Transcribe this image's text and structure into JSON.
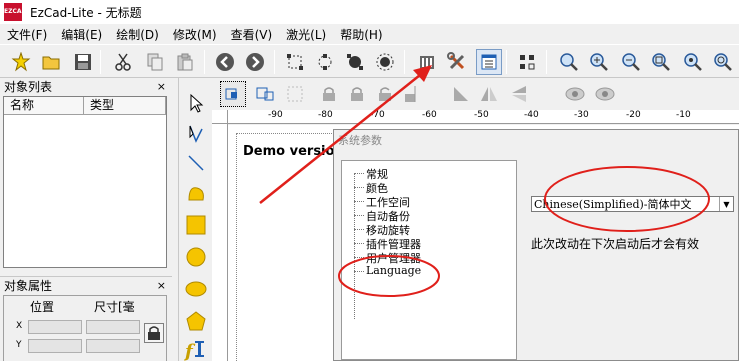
{
  "window": {
    "logo_text": "EZCAD",
    "title": "EzCad-Lite - 无标题"
  },
  "menu": [
    "文件(F)",
    "编辑(E)",
    "绘制(D)",
    "修改(M)",
    "查看(V)",
    "激光(L)",
    "帮助(H)"
  ],
  "toolbar": {
    "buttons": [
      "new-icon",
      "open-icon",
      "save-icon",
      "cut-icon",
      "copy-icon",
      "paste-icon",
      "undo-icon",
      "redo-icon",
      "node-edit-icon",
      "node-select-icon",
      "node-move-icon",
      "node-add-icon",
      "barcode-icon",
      "settings-tools-icon",
      "system-params-icon",
      "object-grid-icon",
      "zoom-icon",
      "zoom-in-icon",
      "zoom-out-icon",
      "zoom-fit-icon",
      "zoom-all-icon",
      "zoom-select-icon"
    ]
  },
  "object_list": {
    "title": "对象列表",
    "close": "×",
    "columns": [
      "名称",
      "类型"
    ]
  },
  "object_props": {
    "title": "对象属性",
    "close": "×",
    "col_position": "位置",
    "col_size": "尺寸[毫",
    "row_x": "X",
    "row_y": "Y"
  },
  "ruler": {
    "ticks": [
      "-90",
      "-80",
      "-70",
      "-60",
      "-50",
      "-40",
      "-30",
      "-20",
      "-10"
    ]
  },
  "canvas": {
    "demo_text": "Demo version"
  },
  "dialog": {
    "title": "系统参数",
    "tree_items": [
      "常规",
      "颜色",
      "工作空间",
      "自动备份",
      "移动旋转",
      "插件管理器",
      "用户管理器",
      "Language"
    ],
    "language_value": "Chinese(Simplified)-简体中文",
    "note": "此次改动在下次启动后才会有效"
  },
  "colors": {
    "annotation": "#e0201b",
    "accent": "#1e5fb4"
  }
}
